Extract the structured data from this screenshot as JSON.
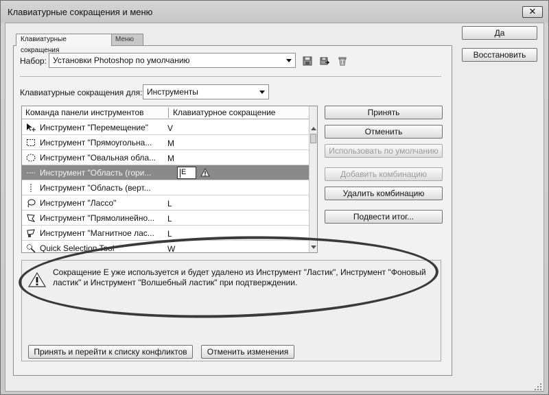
{
  "window": {
    "title": "Клавиатурные сокращения и меню",
    "close_label": "✕"
  },
  "tabs": [
    {
      "label": "Клавиатурные сокращения",
      "active": true
    },
    {
      "label": "Меню",
      "active": false
    }
  ],
  "set": {
    "label": "Набор:",
    "value": "Установки Photoshop по умолчанию"
  },
  "shortcuts_for": {
    "label": "Клавиатурные сокращения для:",
    "value": "Инструменты"
  },
  "table": {
    "columns": [
      "Команда панели инструментов",
      "Клавиатурное сокращение"
    ],
    "rows": [
      {
        "name": "Инструмент \"Перемещение\"",
        "key": "V",
        "icon": "move-tool-icon"
      },
      {
        "name": "Инструмент \"Прямоугольна...",
        "key": "M",
        "icon": "rect-marquee-icon"
      },
      {
        "name": "Инструмент \"Овальная обла...",
        "key": "M",
        "icon": "ellipse-marquee-icon"
      },
      {
        "name": "Инструмент \"Область (гори...",
        "key": "",
        "icon": "single-row-marquee-icon",
        "selected": true,
        "edit_value": "E"
      },
      {
        "name": "Инструмент \"Область (верт...",
        "key": "",
        "icon": "single-column-marquee-icon"
      },
      {
        "name": "Инструмент \"Лассо\"",
        "key": "L",
        "icon": "lasso-icon"
      },
      {
        "name": "Инструмент \"Прямолинейно...",
        "key": "L",
        "icon": "polygonal-lasso-icon"
      },
      {
        "name": "Инструмент \"Магнитное лас...",
        "key": "L",
        "icon": "magnetic-lasso-icon"
      },
      {
        "name": "Quick Selection Tool",
        "key": "W",
        "icon": "quick-selection-icon"
      }
    ]
  },
  "buttons": {
    "ok": "Да",
    "reset": "Восстановить",
    "accept": "Принять",
    "undo": "Отменить",
    "use_default": "Использовать по умолчанию",
    "add_shortcut": "Добавить комбинацию",
    "delete_shortcut": "Удалить комбинацию",
    "summarize": "Подвести итог...",
    "accept_goto": "Принять и перейти к списку конфликтов",
    "undo_changes": "Отменить изменения"
  },
  "message": "Сокращение E уже используется и будет удалено из Инструмент \"Ластик\", Инструмент \"Фоновый ластик\" и Инструмент \"Волшебный ластик\" при подтверждении."
}
